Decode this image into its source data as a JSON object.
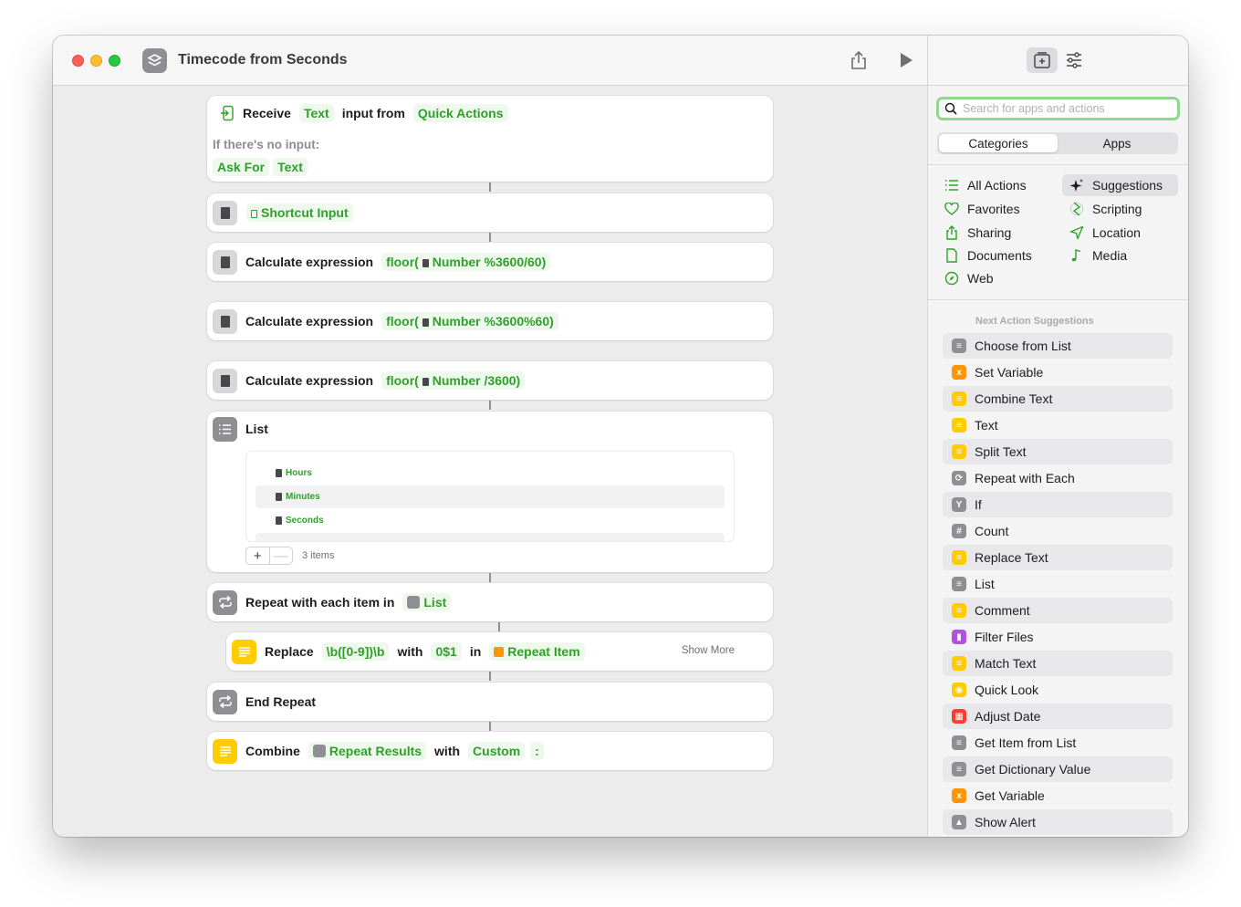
{
  "window": {
    "title": "Timecode from Seconds"
  },
  "actions": {
    "receive": {
      "word1": "Receive",
      "type": "Text",
      "word2": "input from",
      "source": "Quick Actions",
      "noinput_label": "If there's no input:",
      "ask_for": "Ask For",
      "ask_type": "Text"
    },
    "shortcut_input": {
      "label": "Shortcut Input"
    },
    "calc1": {
      "label": "Calculate expression",
      "prefix": "floor(",
      "var": "Number",
      "suffix": "%3600/60)"
    },
    "calc2": {
      "label": "Calculate expression",
      "prefix": "floor(",
      "var": "Number",
      "suffix": "%3600%60)"
    },
    "calc3": {
      "label": "Calculate expression",
      "prefix": "floor(",
      "var": "Number",
      "suffix": "/3600)"
    },
    "list": {
      "label": "List",
      "items": [
        "Hours",
        "Minutes",
        "Seconds"
      ],
      "count": "3 items"
    },
    "repeat": {
      "label": "Repeat with each item in",
      "target": "List"
    },
    "replace": {
      "word1": "Replace",
      "pattern": "\\b([0-9])\\b",
      "word2": "with",
      "replacement": "0$1",
      "word3": "in",
      "target": "Repeat Item",
      "show_more": "Show More"
    },
    "end_repeat": {
      "label": "End Repeat"
    },
    "combine": {
      "word1": "Combine",
      "target": "Repeat Results",
      "word2": "with",
      "mode": "Custom",
      "separator": ":"
    }
  },
  "sidebar": {
    "search_placeholder": "Search for apps and actions",
    "segments": [
      "Categories",
      "Apps"
    ],
    "categories_left": [
      "All Actions",
      "Favorites",
      "Sharing",
      "Documents",
      "Web"
    ],
    "categories_right": [
      "Suggestions",
      "Scripting",
      "Location",
      "Media"
    ],
    "suggestions_header": "Next Action Suggestions",
    "suggestions": [
      {
        "label": "Choose from List",
        "icon": "list-icon",
        "color": "#8e8e93"
      },
      {
        "label": "Set Variable",
        "icon": "variable-icon",
        "color": "#ff9500"
      },
      {
        "label": "Combine Text",
        "icon": "text-icon",
        "color": "#ffcc00"
      },
      {
        "label": "Text",
        "icon": "text-icon",
        "color": "#ffcc00"
      },
      {
        "label": "Split Text",
        "icon": "text-icon",
        "color": "#ffcc00"
      },
      {
        "label": "Repeat with Each",
        "icon": "repeat-icon",
        "color": "#8e8e93"
      },
      {
        "label": "If",
        "icon": "branch-icon",
        "color": "#8e8e93"
      },
      {
        "label": "Count",
        "icon": "hash-icon",
        "color": "#8e8e93"
      },
      {
        "label": "Replace Text",
        "icon": "text-icon",
        "color": "#ffcc00"
      },
      {
        "label": "List",
        "icon": "list-icon",
        "color": "#8e8e93"
      },
      {
        "label": "Comment",
        "icon": "comment-icon",
        "color": "#ffcc00"
      },
      {
        "label": "Filter Files",
        "icon": "file-icon",
        "color": "#af52de"
      },
      {
        "label": "Match Text",
        "icon": "text-icon",
        "color": "#ffcc00"
      },
      {
        "label": "Quick Look",
        "icon": "eye-icon",
        "color": "#ffcc00"
      },
      {
        "label": "Adjust Date",
        "icon": "calendar-icon",
        "color": "#ff3b30"
      },
      {
        "label": "Get Item from List",
        "icon": "list-icon",
        "color": "#8e8e93"
      },
      {
        "label": "Get Dictionary Value",
        "icon": "list-icon",
        "color": "#8e8e93"
      },
      {
        "label": "Get Variable",
        "icon": "variable-icon",
        "color": "#ff9500"
      },
      {
        "label": "Show Alert",
        "icon": "alert-icon",
        "color": "#8e8e93"
      }
    ]
  }
}
